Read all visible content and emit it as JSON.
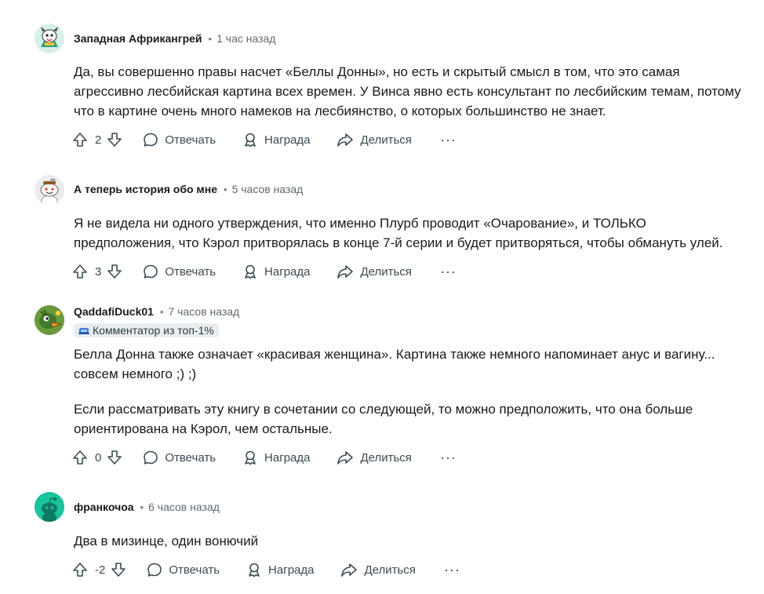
{
  "labels": {
    "reply": "Отвечать",
    "award": "Награда",
    "share": "Делиться",
    "more": "···"
  },
  "comments": [
    {
      "author": "Западная Африкангрей",
      "sep": "•",
      "time": "1 час назад",
      "paragraphs": [
        "Да, вы совершенно правы насчет «Беллы Донны», но есть и скрытый смысл в том, что это самая агрессивно лесбийская картина всех времен. У Винса явно есть консультант по лесбийским темам, потому что в картине очень много намеков на лесбиянство, о которых большинство не знает."
      ],
      "score": "2",
      "avatar_icon": "dog-avatar-icon"
    },
    {
      "author": "А теперь история обо мне",
      "sep": "•",
      "time": "5 часов назад",
      "paragraphs": [
        "Я не видела ни одного утверждения, что именно Плурб проводит «Очарование», и ТОЛЬКО предположения, что Кэрол притворялась в конце 7-й серии и будет притворяться, чтобы обмануть улей."
      ],
      "score": "3",
      "avatar_icon": "snoo-avatar-icon"
    },
    {
      "author": "QaddafiDuck01",
      "sep": "•",
      "time": "7 часов назад",
      "flair": "Комментатор из топ-1%",
      "paragraphs": [
        "Белла Донна также означает «красивая женщина». Картина также немного напоминает анус и вагину... совсем немного ;) ;)",
        "Если рассматривать эту книгу в сочетании со следующей, то можно предположить, что она больше ориентирована на Кэрол, чем остальные."
      ],
      "score": "0",
      "avatar_icon": "duck-avatar-icon"
    },
    {
      "author": "франкочоа",
      "sep": "•",
      "time": "6 часов назад",
      "paragraphs": [
        "Два в мизинце, один вонючий"
      ],
      "score": "-2",
      "avatar_icon": "default-snoo-avatar-icon"
    }
  ]
}
